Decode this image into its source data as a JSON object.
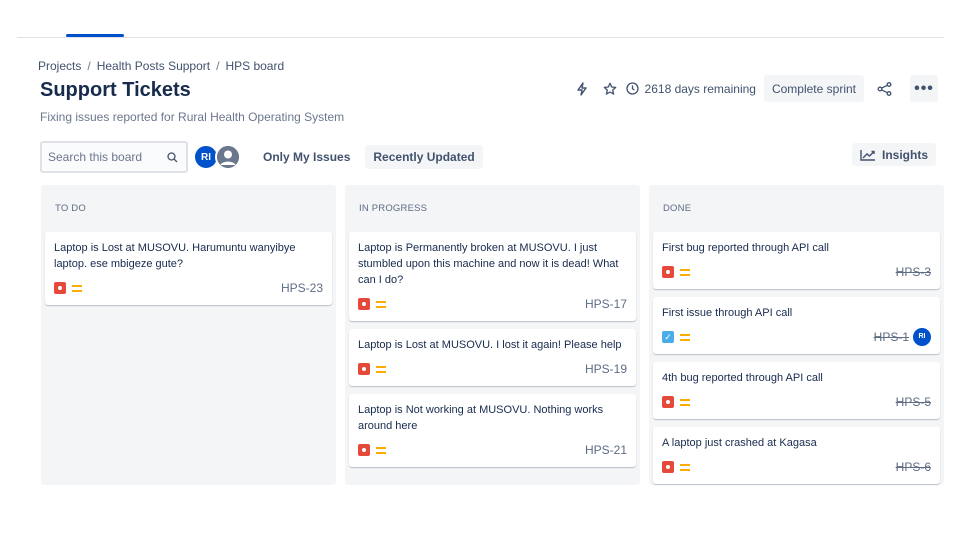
{
  "breadcrumb": [
    "Projects",
    "Health Posts Support",
    "HPS board"
  ],
  "page": {
    "title": "Support Tickets",
    "subtitle": "Fixing issues reported for Rural Health Operating System"
  },
  "header": {
    "days_remaining": "2618 days remaining",
    "complete_sprint": "Complete sprint",
    "more": "•••"
  },
  "toolbar": {
    "search_placeholder": "Search this board",
    "avatar_initials": "RI",
    "only_my_issues": "Only My Issues",
    "recently_updated": "Recently Updated",
    "insights": "Insights"
  },
  "columns": [
    {
      "title": "TO DO",
      "cards": [
        {
          "summary": "Laptop is Lost at MUSOVU. Harumuntu wanyibye laptop. ese mbigeze gute?",
          "key": "HPS-23",
          "type": "bug",
          "done": false
        }
      ]
    },
    {
      "title": "IN PROGRESS",
      "cards": [
        {
          "summary": "Laptop is Permanently broken at MUSOVU. I just stumbled upon this machine and now it is dead! What can I do?",
          "key": "HPS-17",
          "type": "bug",
          "done": false
        },
        {
          "summary": "Laptop is Lost at MUSOVU. I lost it again! Please help",
          "key": "HPS-19",
          "type": "bug",
          "done": false
        },
        {
          "summary": "Laptop is Not working at MUSOVU. Nothing works around here",
          "key": "HPS-21",
          "type": "bug",
          "done": false
        }
      ]
    },
    {
      "title": "DONE",
      "cards": [
        {
          "summary": "First bug reported through API call",
          "key": "HPS-3",
          "type": "bug",
          "done": true
        },
        {
          "summary": "First issue through API call",
          "key": "HPS-1",
          "type": "task",
          "done": true,
          "assignee": "RI"
        },
        {
          "summary": "4th bug reported through API call",
          "key": "HPS-5",
          "type": "bug",
          "done": true
        },
        {
          "summary": "A laptop just crashed at Kagasa",
          "key": "HPS-6",
          "type": "bug",
          "done": true
        }
      ]
    }
  ],
  "colors": {
    "accent": "#0052cc",
    "bug": "#e5493a",
    "task": "#4bade8",
    "priority_medium": "#ffab00",
    "column_bg": "#f4f5f7"
  }
}
